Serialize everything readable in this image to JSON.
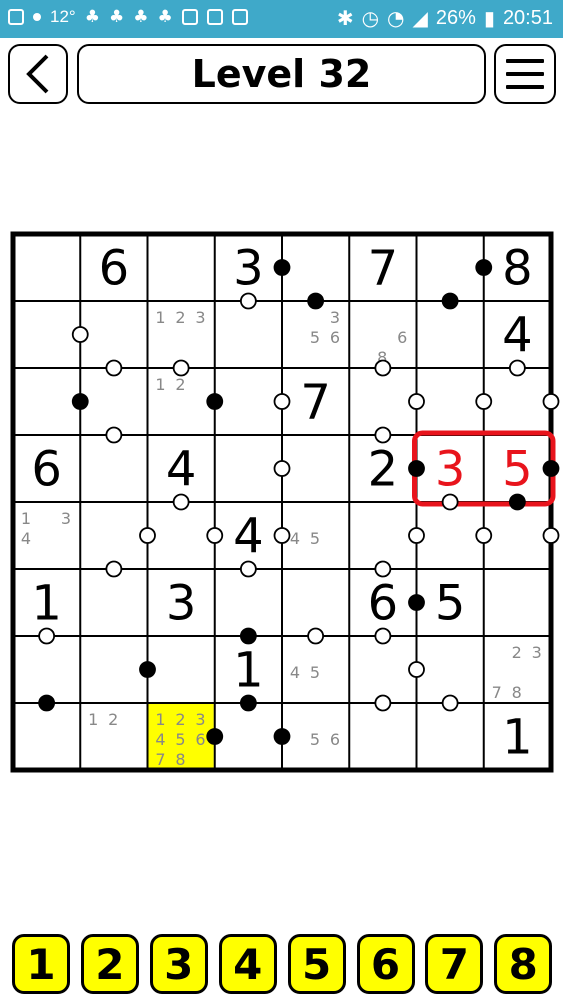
{
  "status_bar": {
    "temperature": "12°",
    "battery": "26%",
    "time": "20:51"
  },
  "header": {
    "title": "Level 32",
    "back_icon": "chevron-left-icon",
    "menu_icon": "hamburger-menu-icon"
  },
  "board": {
    "size": 8,
    "givens": [
      {
        "r": 0,
        "c": 1,
        "v": "6"
      },
      {
        "r": 0,
        "c": 3,
        "v": "3"
      },
      {
        "r": 0,
        "c": 5,
        "v": "7"
      },
      {
        "r": 0,
        "c": 7,
        "v": "8"
      },
      {
        "r": 1,
        "c": 7,
        "v": "4"
      },
      {
        "r": 2,
        "c": 4,
        "v": "7"
      },
      {
        "r": 3,
        "c": 0,
        "v": "6"
      },
      {
        "r": 3,
        "c": 2,
        "v": "4"
      },
      {
        "r": 3,
        "c": 5,
        "v": "2"
      },
      {
        "r": 4,
        "c": 3,
        "v": "4"
      },
      {
        "r": 5,
        "c": 0,
        "v": "1"
      },
      {
        "r": 5,
        "c": 2,
        "v": "3"
      },
      {
        "r": 5,
        "c": 5,
        "v": "6"
      },
      {
        "r": 5,
        "c": 6,
        "v": "5"
      },
      {
        "r": 6,
        "c": 3,
        "v": "1"
      },
      {
        "r": 7,
        "c": 7,
        "v": "1"
      }
    ],
    "entries": [
      {
        "r": 3,
        "c": 6,
        "v": "3"
      },
      {
        "r": 3,
        "c": 7,
        "v": "5"
      }
    ],
    "notes": [
      {
        "r": 1,
        "c": 2,
        "v": [
          "1",
          "2",
          "3",
          "",
          "",
          "",
          "",
          ""
        ]
      },
      {
        "r": 1,
        "c": 4,
        "v": [
          "",
          "",
          "3",
          "",
          "5",
          "6",
          "",
          ""
        ]
      },
      {
        "r": 1,
        "c": 5,
        "v": [
          "",
          "",
          "",
          "",
          "",
          "6",
          "",
          "8"
        ]
      },
      {
        "r": 2,
        "c": 2,
        "v": [
          "1",
          "2",
          "",
          "",
          "",
          "",
          "",
          ""
        ]
      },
      {
        "r": 4,
        "c": 0,
        "v": [
          "1",
          "",
          "3",
          "4",
          "",
          "",
          "",
          ""
        ]
      },
      {
        "r": 4,
        "c": 4,
        "v": [
          "",
          "",
          "",
          "4",
          "5",
          "",
          "",
          ""
        ]
      },
      {
        "r": 6,
        "c": 4,
        "v": [
          "",
          "",
          "",
          "4",
          "5",
          "",
          "",
          ""
        ]
      },
      {
        "r": 6,
        "c": 7,
        "v": [
          "",
          "2",
          "3",
          "",
          "",
          "",
          "7",
          "8"
        ]
      },
      {
        "r": 7,
        "c": 1,
        "v": [
          "1",
          "2",
          "",
          "",
          "",
          "",
          "",
          ""
        ]
      },
      {
        "r": 7,
        "c": 2,
        "v": [
          "1",
          "2",
          "3",
          "4",
          "5",
          "6",
          "7",
          "8"
        ]
      },
      {
        "r": 7,
        "c": 4,
        "v": [
          "",
          "",
          "",
          "",
          "5",
          "6",
          "",
          ""
        ]
      }
    ],
    "selected_cell": {
      "r": 7,
      "c": 2
    },
    "highlight_pair": {
      "r": 3,
      "c1": 6,
      "c2": 7
    },
    "dots": {
      "vertical": [
        {
          "r": 0,
          "c": 3,
          "t": "b"
        },
        {
          "r": 0,
          "c": 6,
          "t": "b"
        },
        {
          "r": 1,
          "c": 0,
          "t": "w"
        },
        {
          "r": 2,
          "c": 0,
          "t": "b"
        },
        {
          "r": 2,
          "c": 2,
          "t": "b"
        },
        {
          "r": 2,
          "c": 3,
          "t": "w"
        },
        {
          "r": 2,
          "c": 5,
          "t": "w"
        },
        {
          "r": 2,
          "c": 6,
          "t": "w"
        },
        {
          "r": 2,
          "c": 7,
          "t": "w"
        },
        {
          "r": 3,
          "c": 3,
          "t": "w"
        },
        {
          "r": 3,
          "c": 5,
          "t": "b"
        },
        {
          "r": 3,
          "c": 7,
          "t": "b"
        },
        {
          "r": 4,
          "c": 1,
          "t": "w"
        },
        {
          "r": 4,
          "c": 2,
          "t": "w"
        },
        {
          "r": 4,
          "c": 3,
          "t": "w"
        },
        {
          "r": 4,
          "c": 5,
          "t": "w"
        },
        {
          "r": 4,
          "c": 6,
          "t": "w"
        },
        {
          "r": 4,
          "c": 7,
          "t": "w"
        },
        {
          "r": 5,
          "c": 5,
          "t": "b"
        },
        {
          "r": 6,
          "c": 1,
          "t": "b"
        },
        {
          "r": 6,
          "c": 5,
          "t": "w"
        },
        {
          "r": 7,
          "c": 2,
          "t": "b"
        },
        {
          "r": 7,
          "c": 3,
          "t": "b"
        }
      ],
      "horizontal": [
        {
          "r": 1,
          "c": 3,
          "t": "w"
        },
        {
          "r": 1,
          "c": 4,
          "t": "b"
        },
        {
          "r": 1,
          "c": 6,
          "t": "b"
        },
        {
          "r": 2,
          "c": 1,
          "t": "w"
        },
        {
          "r": 2,
          "c": 2,
          "t": "w"
        },
        {
          "r": 2,
          "c": 5,
          "t": "w"
        },
        {
          "r": 2,
          "c": 7,
          "t": "w"
        },
        {
          "r": 3,
          "c": 1,
          "t": "w"
        },
        {
          "r": 3,
          "c": 5,
          "t": "w"
        },
        {
          "r": 4,
          "c": 2,
          "t": "w"
        },
        {
          "r": 4,
          "c": 6,
          "t": "w"
        },
        {
          "r": 4,
          "c": 7,
          "t": "b"
        },
        {
          "r": 5,
          "c": 1,
          "t": "w"
        },
        {
          "r": 5,
          "c": 3,
          "t": "w"
        },
        {
          "r": 5,
          "c": 5,
          "t": "w"
        },
        {
          "r": 6,
          "c": 0,
          "t": "w"
        },
        {
          "r": 6,
          "c": 3,
          "t": "b"
        },
        {
          "r": 6,
          "c": 4,
          "t": "w"
        },
        {
          "r": 6,
          "c": 5,
          "t": "w"
        },
        {
          "r": 7,
          "c": 0,
          "t": "b"
        },
        {
          "r": 7,
          "c": 3,
          "t": "b"
        },
        {
          "r": 7,
          "c": 5,
          "t": "w"
        },
        {
          "r": 7,
          "c": 6,
          "t": "w"
        }
      ]
    }
  },
  "number_buttons": [
    "1",
    "2",
    "3",
    "4",
    "5",
    "6",
    "7",
    "8"
  ],
  "colors": {
    "status_bar": "#3fa9c9",
    "entry": "#e8141c",
    "highlight": "#e8141c",
    "selected": "#ffff00",
    "button": "#ffff00"
  }
}
